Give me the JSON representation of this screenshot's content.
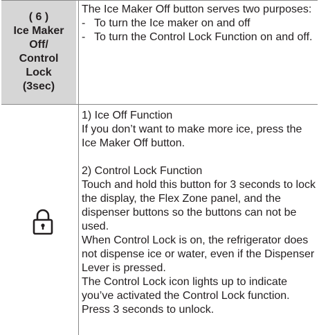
{
  "header": {
    "line1": "( 6 )",
    "line2": "Ice Maker",
    "line3": "Off/",
    "line4": "Control",
    "line5": "Lock",
    "line6": "(3sec)"
  },
  "intro": {
    "text": "The Ice Maker Off button serves two purposes:",
    "bullets": [
      "To turn the Ice maker on and off",
      "To turn the Control Lock Function on and off."
    ]
  },
  "sections": {
    "ice_off_heading": "1) Ice Off Function",
    "ice_off_text": "If you don’t want to make more ice, press the Ice Maker Off button.",
    "lock_heading": "2) Control Lock Function",
    "lock_text1": "Touch and hold this button for 3 seconds to lock the display, the Flex Zone panel, and the dispenser buttons so the buttons can not be used.",
    "lock_text2": "When Control Lock is on, the refrigerator does not dispense ice or water, even if the Dispenser Lever is pressed.",
    "lock_text3": "The Control Lock icon lights up to indicate you’ve activated the Control Lock function. Press 3 seconds to unlock."
  },
  "icons": {
    "lock": "lock-icon"
  },
  "colors": {
    "header_bg": "#d6d6d6",
    "rule": "#888888",
    "text": "#231f20"
  }
}
